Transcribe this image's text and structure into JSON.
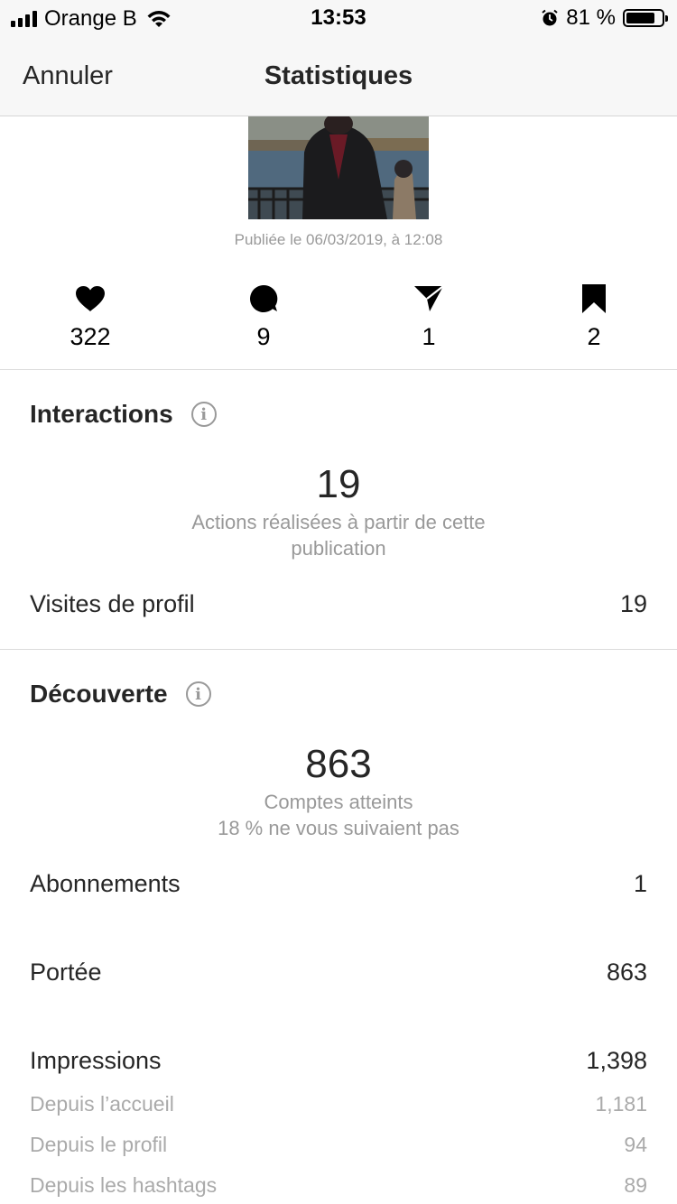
{
  "status_bar": {
    "carrier": "Orange B",
    "time": "13:53",
    "battery": "81 %",
    "battery_level": 0.81
  },
  "nav": {
    "cancel_label": "Annuler",
    "title": "Statistiques"
  },
  "post": {
    "published": "Publiée le 06/03/2019, à 12:08"
  },
  "counts": [
    {
      "icon": "heart-icon",
      "value": "322"
    },
    {
      "icon": "comment-icon",
      "value": "9"
    },
    {
      "icon": "share-icon",
      "value": "1"
    },
    {
      "icon": "bookmark-icon",
      "value": "2"
    }
  ],
  "interactions": {
    "title": "Interactions",
    "total": "19",
    "caption_line1": "Actions réalisées à partir de cette",
    "caption_line2": "publication",
    "rows": [
      {
        "label": "Visites de profil",
        "value": "19"
      }
    ]
  },
  "discovery": {
    "title": "Découverte",
    "total": "863",
    "caption_line1": "Comptes atteints",
    "caption_line2": "18 % ne vous suivaient pas",
    "rows": [
      {
        "label": "Abonnements",
        "value": "1"
      },
      {
        "label": "Portée",
        "value": "863"
      },
      {
        "label": "Impressions",
        "value": "1,398"
      }
    ],
    "sub_rows": [
      {
        "label": "Depuis l’accueil",
        "value": "1,181"
      },
      {
        "label": "Depuis le profil",
        "value": "94"
      },
      {
        "label": "Depuis les hashtags",
        "value": "89"
      }
    ]
  }
}
